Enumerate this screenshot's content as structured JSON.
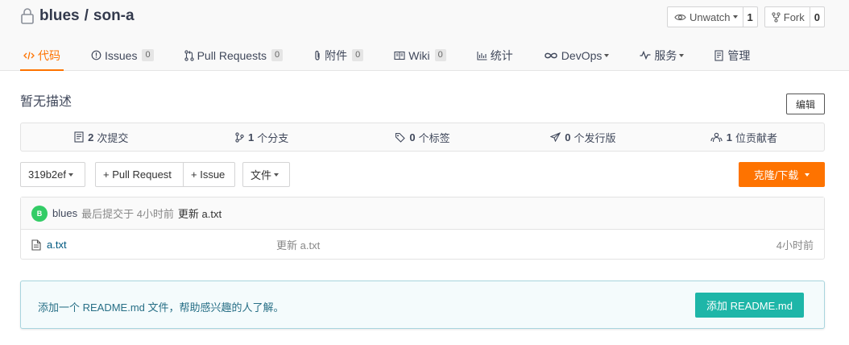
{
  "repo": {
    "owner": "blues",
    "separator": "/",
    "name": "son-a"
  },
  "actions": {
    "watch_label": "Unwatch",
    "watch_count": "1",
    "fork_label": "Fork",
    "fork_count": "0"
  },
  "tabs": [
    {
      "label": "代码",
      "badge": null,
      "icon": "code-icon",
      "active": true
    },
    {
      "label": "Issues",
      "badge": "0",
      "icon": "issue-icon"
    },
    {
      "label": "Pull Requests",
      "badge": "0",
      "icon": "pull-request-icon"
    },
    {
      "label": "附件",
      "badge": "0",
      "icon": "paperclip-icon"
    },
    {
      "label": "Wiki",
      "badge": "0",
      "icon": "book-icon"
    },
    {
      "label": "统计",
      "badge": null,
      "icon": "bar-chart-icon"
    },
    {
      "label": "DevOps",
      "badge": null,
      "icon": "infinity-icon",
      "dropdown": true
    },
    {
      "label": "服务",
      "badge": null,
      "icon": "pulse-icon",
      "dropdown": true
    },
    {
      "label": "管理",
      "badge": null,
      "icon": "settings-doc-icon"
    }
  ],
  "description": "暂无描述",
  "edit_label": "编辑",
  "stats": [
    {
      "count": "2",
      "label": "次提交",
      "icon": "commits-icon"
    },
    {
      "count": "1",
      "label": "个分支",
      "icon": "branch-icon"
    },
    {
      "count": "0",
      "label": "个标签",
      "icon": "tag-icon"
    },
    {
      "count": "0",
      "label": "个发行版",
      "icon": "release-icon"
    },
    {
      "count": "1",
      "label": "位贡献者",
      "icon": "contributors-icon"
    }
  ],
  "toolbar": {
    "branch": "319b2ef",
    "pull_request": "+ Pull Request",
    "issue": "+ Issue",
    "file_menu": "文件",
    "clone": "克隆/下载"
  },
  "commit": {
    "avatar_letter": "B",
    "author": "blues",
    "meta": "最后提交于 4小时前",
    "message": "更新 a.txt"
  },
  "files": [
    {
      "name": "a.txt",
      "commit": "更新 a.txt",
      "time": "4小时前"
    }
  ],
  "readme": {
    "text": "添加一个 README.md 文件，帮助感兴趣的人了解。",
    "button": "添加 README.md"
  },
  "colors": {
    "accent": "#fe7300",
    "teal": "#1eb6a8",
    "avatar": "#33cc66"
  }
}
